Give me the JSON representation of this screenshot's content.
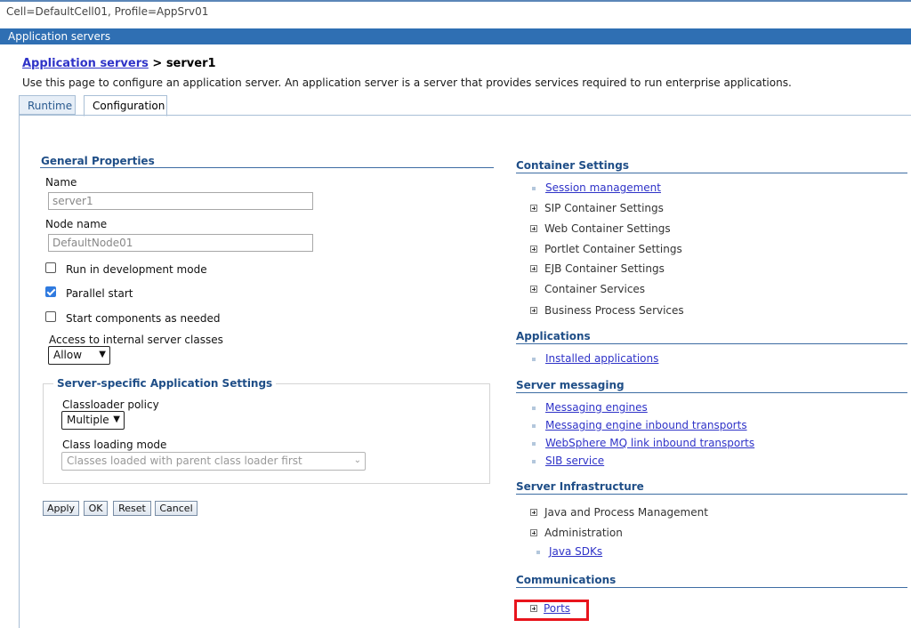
{
  "context": "Cell=DefaultCell01, Profile=AppSrv01",
  "title_bar": "Application servers",
  "breadcrumb": {
    "link": "Application servers",
    "separator": " > ",
    "current": "server1"
  },
  "description": "Use this page to configure an application server. An application server is a server that provides services required to run enterprise applications.",
  "tabs": [
    "Runtime",
    "Configuration"
  ],
  "general": {
    "heading": "General Properties",
    "name_label": "Name",
    "name_value": "server1",
    "node_label": "Node name",
    "node_value": "DefaultNode01",
    "dev_mode": "Run in development mode",
    "parallel_start": "Parallel start",
    "start_components": "Start components as needed",
    "access_label": "Access to internal server classes",
    "access_value": "Allow"
  },
  "server_specific": {
    "heading": "Server-specific Application Settings",
    "classloader_label": "Classloader policy",
    "classloader_value": "Multiple",
    "loading_label": "Class loading mode",
    "loading_value": "Classes loaded with parent class loader first"
  },
  "buttons": {
    "apply": "Apply",
    "ok": "OK",
    "reset": "Reset",
    "cancel": "Cancel"
  },
  "container": {
    "heading": "Container Settings",
    "session": "Session management",
    "sip": "SIP Container Settings",
    "web": "Web Container Settings",
    "portlet": "Portlet Container Settings",
    "ejb": "EJB Container Settings",
    "services": "Container Services",
    "bps": "Business Process Services"
  },
  "applications": {
    "heading": "Applications",
    "installed": "Installed applications"
  },
  "messaging": {
    "heading": "Server messaging",
    "engines": "Messaging engines",
    "inbound": "Messaging engine inbound transports",
    "mq": "WebSphere MQ link inbound transports",
    "sib": "SIB service"
  },
  "infrastructure": {
    "heading": "Server Infrastructure",
    "java": "Java and Process Management",
    "admin": "Administration",
    "sdks": "Java SDKs"
  },
  "communications": {
    "heading": "Communications",
    "ports": "Ports"
  },
  "colors": {
    "accent": "#2f6fb3",
    "link": "#2f33c8",
    "highlight": "#e8141c"
  }
}
